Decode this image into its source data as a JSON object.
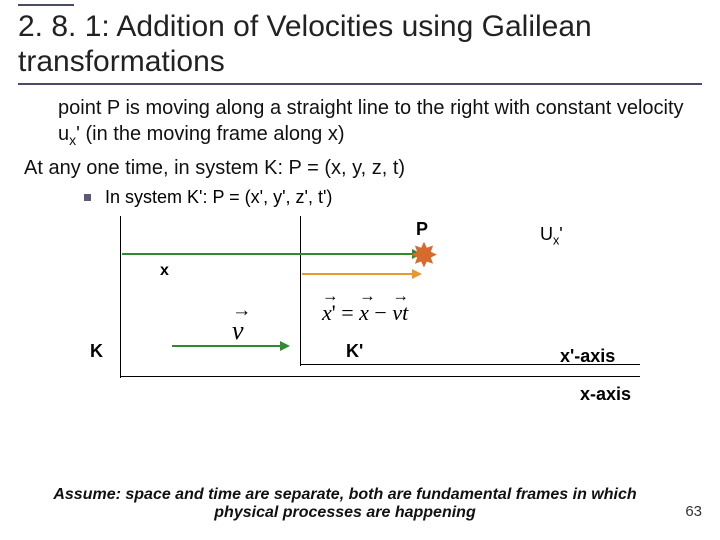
{
  "title": "2. 8. 1: Addition of Velocities using Galilean transformations",
  "para1": "point P is moving along a straight line to the right with constant velocity u",
  "para1_sub": "x",
  "para1_after": "' (in the moving frame along x)",
  "para2": "At any one time, in system K: P = (x, y, z, t)",
  "bullet1": "In system K': P = (x', y', z', t')",
  "diagram": {
    "P": "P",
    "Ux": "U",
    "Ux_sub": "x",
    "Ux_prime": "'",
    "x": "x",
    "K": "K",
    "Kprime": "K'",
    "xprime_axis": "x'-axis",
    "x_axis": "x-axis",
    "v": "v",
    "eq_lhs": "x",
    "eq_prime": "'",
    "eq_eq": " = ",
    "eq_x": "x",
    "eq_minus": " − ",
    "eq_v": "v",
    "eq_t": "t"
  },
  "footer": "Assume: space and time are separate, both are fundamental frames in which physical processes are happening",
  "slide_number": "63"
}
